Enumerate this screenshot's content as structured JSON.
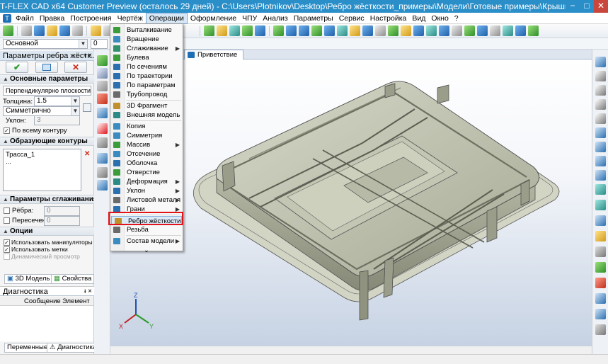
{
  "window": {
    "title": "T-FLEX CAD x64 Customer Preview (осталось 29 дней) - C:\\Users\\Plotnikov\\Desktop\\Ребро жёсткости_примеры\\Модели\\Готовые примеры\\Крышка ящика.grb",
    "minimize": "−",
    "maximize": "□",
    "close": "✕"
  },
  "menubar": {
    "items": [
      "Файл",
      "Правка",
      "Построения",
      "Чертёж",
      "Операции",
      "Оформление",
      "ЧПУ",
      "Анализ",
      "Параметры",
      "Сервис",
      "Настройка",
      "Вид",
      "Окно",
      "?"
    ],
    "active_index": 4
  },
  "toolbar2": {
    "layer_combo": "Основной",
    "field_value": "0"
  },
  "left_panel": {
    "title": "Параметры ребра жёстк...",
    "title_pin": "ᵻ ×",
    "ok_label": "✔",
    "sections": {
      "main": "Основные параметры",
      "contours": "Образующие контуры",
      "smoothing": "Параметры сглаживания",
      "options": "Опции"
    },
    "direction_combo": "Перпендикулярно плоскости контур",
    "thickness_label": "Толщина:",
    "thickness_value": "1.5",
    "symmetry_combo": "Симметрично",
    "angle_label": "Уклон:",
    "angle_value": "3",
    "full_contour_label": "По всему контуру",
    "contour_list": [
      "Трасса_1",
      "..."
    ],
    "ribs_label": "Рёбра:",
    "ribs_value": "0",
    "intersections_label": "Пересечения:",
    "intersections_value": "0",
    "use_manipulators": "Использовать манипуляторы",
    "use_marks": "Использовать метки",
    "dynamic_preview": "Динамический просмотр",
    "tab_model": "3D Модель",
    "tab_properties": "Свойства"
  },
  "diagnostics": {
    "title": "Диагностика",
    "pin": "ᵻ ×",
    "columns": [
      "",
      "Сообщение",
      "Элемент"
    ],
    "tab_variables": "Переменные",
    "tab_diagnostics": "Диагностика"
  },
  "document_tab": {
    "label": "Приветствие"
  },
  "operations_menu": {
    "items": [
      {
        "label": "Выталкивание",
        "submenu": false,
        "color": "#3a9c3a"
      },
      {
        "label": "Вращение",
        "submenu": false,
        "color": "#3a8cc0"
      },
      {
        "label": "Сглаживание",
        "submenu": true,
        "color": "#2f8f6f"
      },
      {
        "label": "Булева",
        "submenu": false,
        "color": "#3a9c3a"
      },
      {
        "label": "По сечениям",
        "submenu": false,
        "color": "#2a6fb0"
      },
      {
        "label": "По траектории",
        "submenu": false,
        "color": "#2a6fb0"
      },
      {
        "label": "По параметрам",
        "submenu": false,
        "color": "#2a6fb0"
      },
      {
        "label": "Трубопровод",
        "submenu": false,
        "color": "#6a6a6a"
      },
      {
        "label": "3D Фрагмент",
        "submenu": false,
        "color": "#c0902a"
      },
      {
        "label": "Внешняя модель",
        "submenu": false,
        "color": "#2a8b86"
      },
      {
        "label": "Копия",
        "submenu": false,
        "color": "#3a8cc0"
      },
      {
        "label": "Симметрия",
        "submenu": false,
        "color": "#3a8cc0"
      },
      {
        "label": "Массив",
        "submenu": true,
        "color": "#3a9c3a"
      },
      {
        "label": "Отсечение",
        "submenu": false,
        "color": "#3a8cc0"
      },
      {
        "label": "Оболочка",
        "submenu": false,
        "color": "#2a6fb0"
      },
      {
        "label": "Отверстие",
        "submenu": false,
        "color": "#3a9c3a"
      },
      {
        "label": "Деформация",
        "submenu": true,
        "color": "#2a8b86"
      },
      {
        "label": "Уклон",
        "submenu": true,
        "color": "#2a6fb0"
      },
      {
        "label": "Листовой металл",
        "submenu": true,
        "color": "#6a6a6a"
      },
      {
        "label": "Грани",
        "submenu": true,
        "color": "#2a6fb0"
      },
      {
        "label": "Ребро жёсткости",
        "submenu": false,
        "color": "#c0902a"
      },
      {
        "label": "Резьба",
        "submenu": false,
        "color": "#6a6a6a"
      },
      {
        "label": "Состав модели",
        "submenu": true,
        "color": "#3a8cc0"
      }
    ],
    "highlighted_index": 20,
    "more": "⌄"
  },
  "axes": {
    "x": "X",
    "y": "Y",
    "z": "Z"
  },
  "colors": {
    "title_bar": "#2a8ec8",
    "highlight_box": "#e1141b",
    "model_body": "#b9bca8"
  }
}
